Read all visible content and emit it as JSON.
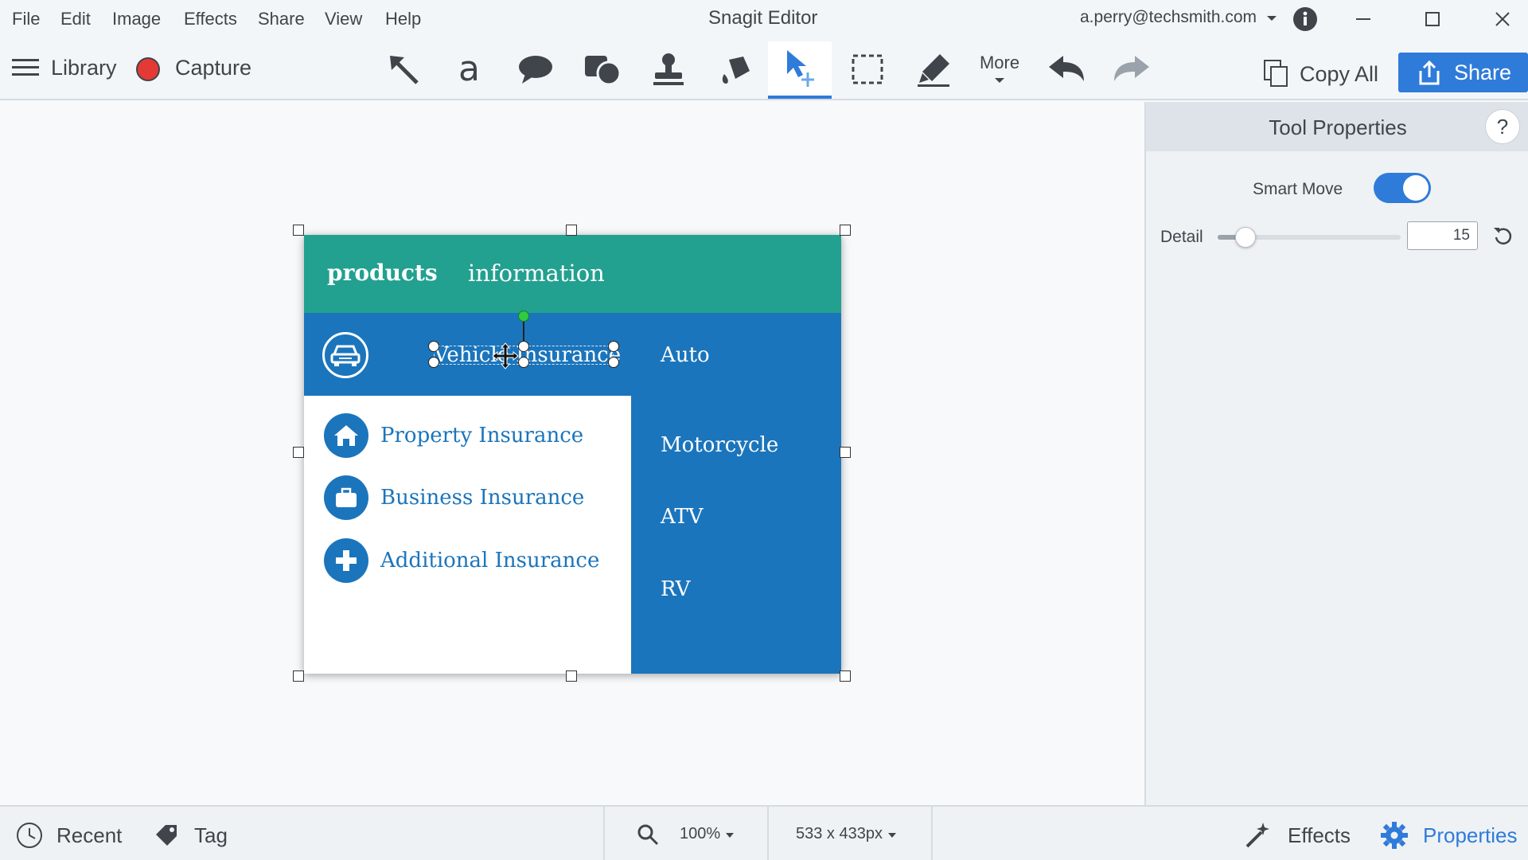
{
  "menu": {
    "items": [
      "File",
      "Edit",
      "Image",
      "Effects",
      "Share",
      "View",
      "Help"
    ],
    "app_title": "Snagit Editor",
    "account": "a.perry@techsmith.com"
  },
  "toolbar": {
    "library_label": "Library",
    "capture_label": "Capture",
    "more_label": "More",
    "copy_all_label": "Copy All",
    "share_label": "Share",
    "tools": [
      "arrow-icon",
      "text-icon",
      "callout-icon",
      "shape-icon",
      "stamp-icon",
      "fill-icon",
      "move-icon",
      "selection-icon",
      "highlighter-icon"
    ],
    "active_tool": "move-icon"
  },
  "image": {
    "brand_bold": "products",
    "brand_regular": "information",
    "vehicle_label": "Vehicle Insurance",
    "sub_links": [
      "Auto",
      "Motorcycle",
      "ATV",
      "RV"
    ],
    "insurance_items": [
      "Property Insurance",
      "Business Insurance",
      "Additional Insurance"
    ]
  },
  "panel": {
    "title": "Tool Properties",
    "help_label": "?",
    "smart_move_label": "Smart Move",
    "smart_move_on": true,
    "detail_label": "Detail",
    "detail_value": "15"
  },
  "statusbar": {
    "recent_label": "Recent",
    "tag_label": "Tag",
    "zoom_label": "100%",
    "dimensions_label": "533 x 433px",
    "effects_label": "Effects",
    "properties_label": "Properties"
  },
  "colors": {
    "accent": "#2f7bd9",
    "teal": "#22a090",
    "blue": "#1b75bc",
    "record": "#e53935"
  }
}
